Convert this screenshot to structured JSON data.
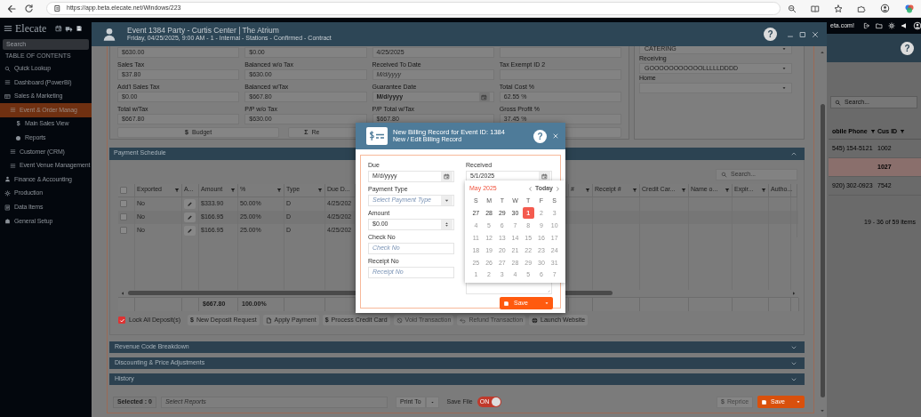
{
  "browser": {
    "url": "https://app.beta.elecate.net/Windows/223"
  },
  "sidebar": {
    "logo": "Elecate",
    "search_placeholder": "Search",
    "heading": "TABLE OF CONTENTS",
    "items": [
      {
        "label": "Quick Lookup",
        "selected": false
      },
      {
        "label": "Dashboard (PowerBI)",
        "selected": false
      },
      {
        "label": "Sales & Marketing",
        "selected": false,
        "children": [
          {
            "label": "Event & Order Manag",
            "selected": true,
            "children": [
              {
                "label": "Main Sales View",
                "glyph": "$",
                "selected": false
              },
              {
                "label": "Reports",
                "selected": false
              }
            ]
          },
          {
            "label": "Customer (CRM)",
            "selected": false
          },
          {
            "label": "Event Venue Management",
            "selected": false
          }
        ]
      },
      {
        "label": "Finance & Accounting",
        "selected": false
      },
      {
        "label": "Production",
        "selected": false
      },
      {
        "label": "Data Items",
        "selected": false
      },
      {
        "label": "General Setup",
        "selected": false
      }
    ]
  },
  "background_app": {
    "banner": "eta.com!",
    "help": "?",
    "search_placeholder": "Search...",
    "columns": [
      "obile Phone",
      "Cus ID"
    ],
    "rows": [
      {
        "phone": "545) 154-5121",
        "id": "1002",
        "selected": false
      },
      {
        "id": "1027",
        "selected": true
      },
      {
        "phone": "920) 302-0923",
        "id": "7542",
        "selected": false
      }
    ],
    "pager": "19 - 36 of 59 items"
  },
  "event_window": {
    "title": "Event 1384 Party - Curtis Center | The Atrium",
    "subtitle": "Friday, 04/25/2025, 9:00 AM - 1 - Internal - Stations - Confirmed - Contract",
    "help": "?",
    "summary_fields": [
      {
        "kind": "text",
        "value": "$630.00"
      },
      {
        "kind": "text",
        "value": "$0.00"
      },
      {
        "kind": "text",
        "value": "4/25/2025"
      },
      {
        "kind": "text"
      },
      {
        "kind": "text",
        "label": "Sales Tax",
        "value": "$37.80"
      },
      {
        "kind": "text",
        "label": "Balanced w/o Tax",
        "value": "$630.00"
      },
      {
        "kind": "text",
        "label": "Received To Date",
        "placeholder": "M/d/yyyy"
      },
      {
        "kind": "text",
        "label": "Tax Exempt ID 2"
      },
      {
        "kind": "text",
        "label": "Add'l Sales Tax",
        "value": "$0.00"
      },
      {
        "kind": "text",
        "label": "Balanced w/Tax",
        "value": "$667.80"
      },
      {
        "kind": "date",
        "label": "Guarantee Date",
        "value": "M/d/yyyy"
      },
      {
        "kind": "text",
        "label": "Total Cost %",
        "value": "62.55 %"
      },
      {
        "kind": "text",
        "label": "Total w/Tax",
        "value": "$667.80"
      },
      {
        "kind": "text",
        "label": "P/P w/o Tax",
        "value": "$630.00"
      },
      {
        "kind": "text",
        "label": "P/P Total w/Tax",
        "value": "$667.80"
      },
      {
        "kind": "text",
        "label": "Gross Profit %",
        "value": "37.45 %"
      }
    ],
    "summary_buttons": [
      {
        "kind": "labeled",
        "glyph": "$",
        "label": "Budget"
      },
      {
        "kind": "labeled",
        "glyph": "Σ",
        "label": "Re"
      },
      {
        "kind": "blank"
      }
    ],
    "side_selects": [
      {
        "value": "CATERING"
      },
      {
        "label": "Receiving",
        "value": "GOOOOOOOOOOOLLLLLDDDD"
      },
      {
        "label": "Home"
      }
    ],
    "payment": {
      "title": "Payment Schedule",
      "expanded": true,
      "search_placeholder": "Search...",
      "all_selected": false,
      "columns": [
        {
          "label": "Exported",
          "filter": true
        },
        {
          "label": "A...",
          "filter": false
        },
        {
          "label": "Amount",
          "filter": true
        },
        {
          "label": "%",
          "filter": true
        },
        {
          "label": "Type",
          "filter": true
        },
        {
          "label": "Due D...",
          "filter": false
        },
        {
          "label": "#",
          "filter": true
        },
        {
          "label": "Receipt #",
          "filter": true
        },
        {
          "label": "Credit Car...",
          "filter": true
        },
        {
          "label": "Name o...",
          "filter": true
        },
        {
          "label": "Expir...",
          "filter": true
        },
        {
          "label": "Autho...",
          "filter": false
        }
      ],
      "rows": [
        {
          "selected": false,
          "exported": "No",
          "amount": "$333.90",
          "percent": "50.00%",
          "type": "D",
          "due": "4/25/202"
        },
        {
          "selected": false,
          "exported": "No",
          "amount": "$166.95",
          "percent": "25.00%",
          "type": "D",
          "due": "4/25/202"
        },
        {
          "selected": false,
          "exported": "No",
          "amount": "$166.95",
          "percent": "25.00%",
          "type": "D",
          "due": "4/25/202"
        }
      ],
      "totals": {
        "amount": "$667.80",
        "percent": "100.00%"
      },
      "lock": {
        "label": "Lock All Deposit(s)",
        "checked": true
      },
      "actions": [
        {
          "glyph": "$",
          "label": "New Deposit Request",
          "disabled": false
        },
        {
          "label": "Apply Payment",
          "disabled": false
        },
        {
          "glyph": "$",
          "label": "Process Credit Card",
          "disabled": false
        },
        {
          "label": "Void Transaction",
          "disabled": true
        },
        {
          "label": "Refund Transaction",
          "disabled": true
        },
        {
          "label": "Launch Website",
          "disabled": false
        }
      ]
    },
    "sections": [
      {
        "title": "Revenue Code Breakdown",
        "expanded": false
      },
      {
        "title": "Discounting & Price Adjustments",
        "expanded": false
      },
      {
        "title": "History",
        "expanded": false
      }
    ],
    "footer": {
      "selected": "Selected : 0",
      "reports_placeholder": "Select Reports",
      "print_to": "Print To",
      "save_file": "Save File",
      "save_file_toggle": {
        "on": true,
        "text": "ON"
      },
      "reprice": {
        "glyph": "$",
        "label": "Reprice",
        "disabled": true
      },
      "save": "Save"
    }
  },
  "modal": {
    "title": "New Billing Record for Event ID: 1384",
    "subtitle": "New / Edit Billing Record",
    "help": "?",
    "fields": [
      {
        "kind": "date",
        "label": "Due",
        "value": "M/d/yyyy"
      },
      {
        "kind": "select",
        "label": "Payment Type",
        "placeholder": "Select Payment Type"
      },
      {
        "kind": "number",
        "label": "Amount",
        "value": "$0.00"
      },
      {
        "kind": "text",
        "label": "Check No",
        "placeholder": "Check No"
      },
      {
        "kind": "text",
        "label": "Receipt No",
        "placeholder": "Receipt No"
      }
    ],
    "received": {
      "label": "Received",
      "value": "5/1/2025"
    },
    "calendar": {
      "title": "May 2025",
      "today": "Today",
      "weekdays": [
        "S",
        "M",
        "T",
        "W",
        "T",
        "F",
        "S"
      ],
      "days": [
        {
          "day": "27",
          "disabled": false,
          "selected": false
        },
        {
          "day": "28",
          "disabled": false,
          "selected": false
        },
        {
          "day": "29",
          "disabled": false,
          "selected": false
        },
        {
          "day": "30",
          "disabled": false,
          "selected": false
        },
        {
          "day": "1",
          "disabled": false,
          "selected": true
        },
        {
          "day": "2",
          "disabled": true,
          "selected": false
        },
        {
          "day": "3",
          "disabled": true,
          "selected": false
        },
        {
          "day": "4",
          "disabled": true,
          "selected": false
        },
        {
          "day": "5",
          "disabled": true,
          "selected": false
        },
        {
          "day": "6",
          "disabled": true,
          "selected": false
        },
        {
          "day": "7",
          "disabled": true,
          "selected": false
        },
        {
          "day": "8",
          "disabled": true,
          "selected": false
        },
        {
          "day": "9",
          "disabled": true,
          "selected": false
        },
        {
          "day": "10",
          "disabled": true,
          "selected": false
        },
        {
          "day": "11",
          "disabled": true,
          "selected": false
        },
        {
          "day": "12",
          "disabled": true,
          "selected": false
        },
        {
          "day": "13",
          "disabled": true,
          "selected": false
        },
        {
          "day": "14",
          "disabled": true,
          "selected": false
        },
        {
          "day": "15",
          "disabled": true,
          "selected": false
        },
        {
          "day": "16",
          "disabled": true,
          "selected": false
        },
        {
          "day": "17",
          "disabled": true,
          "selected": false
        },
        {
          "day": "18",
          "disabled": true,
          "selected": false
        },
        {
          "day": "19",
          "disabled": true,
          "selected": false
        },
        {
          "day": "20",
          "disabled": true,
          "selected": false
        },
        {
          "day": "21",
          "disabled": true,
          "selected": false
        },
        {
          "day": "22",
          "disabled": true,
          "selected": false
        },
        {
          "day": "23",
          "disabled": true,
          "selected": false
        },
        {
          "day": "24",
          "disabled": true,
          "selected": false
        },
        {
          "day": "25",
          "disabled": true,
          "selected": false
        },
        {
          "day": "26",
          "disabled": true,
          "selected": false
        },
        {
          "day": "27",
          "disabled": true,
          "selected": false
        },
        {
          "day": "28",
          "disabled": true,
          "selected": false
        },
        {
          "day": "29",
          "disabled": true,
          "selected": false
        },
        {
          "day": "30",
          "disabled": true,
          "selected": false
        },
        {
          "day": "31",
          "disabled": true,
          "selected": false
        },
        {
          "day": "1",
          "disabled": true,
          "selected": false
        },
        {
          "day": "2",
          "disabled": true,
          "selected": false
        },
        {
          "day": "3",
          "disabled": true,
          "selected": false
        },
        {
          "day": "4",
          "disabled": true,
          "selected": false
        },
        {
          "day": "5",
          "disabled": true,
          "selected": false
        },
        {
          "day": "6",
          "disabled": true,
          "selected": false
        },
        {
          "day": "7",
          "disabled": true,
          "selected": false
        }
      ]
    },
    "save": "Save"
  }
}
